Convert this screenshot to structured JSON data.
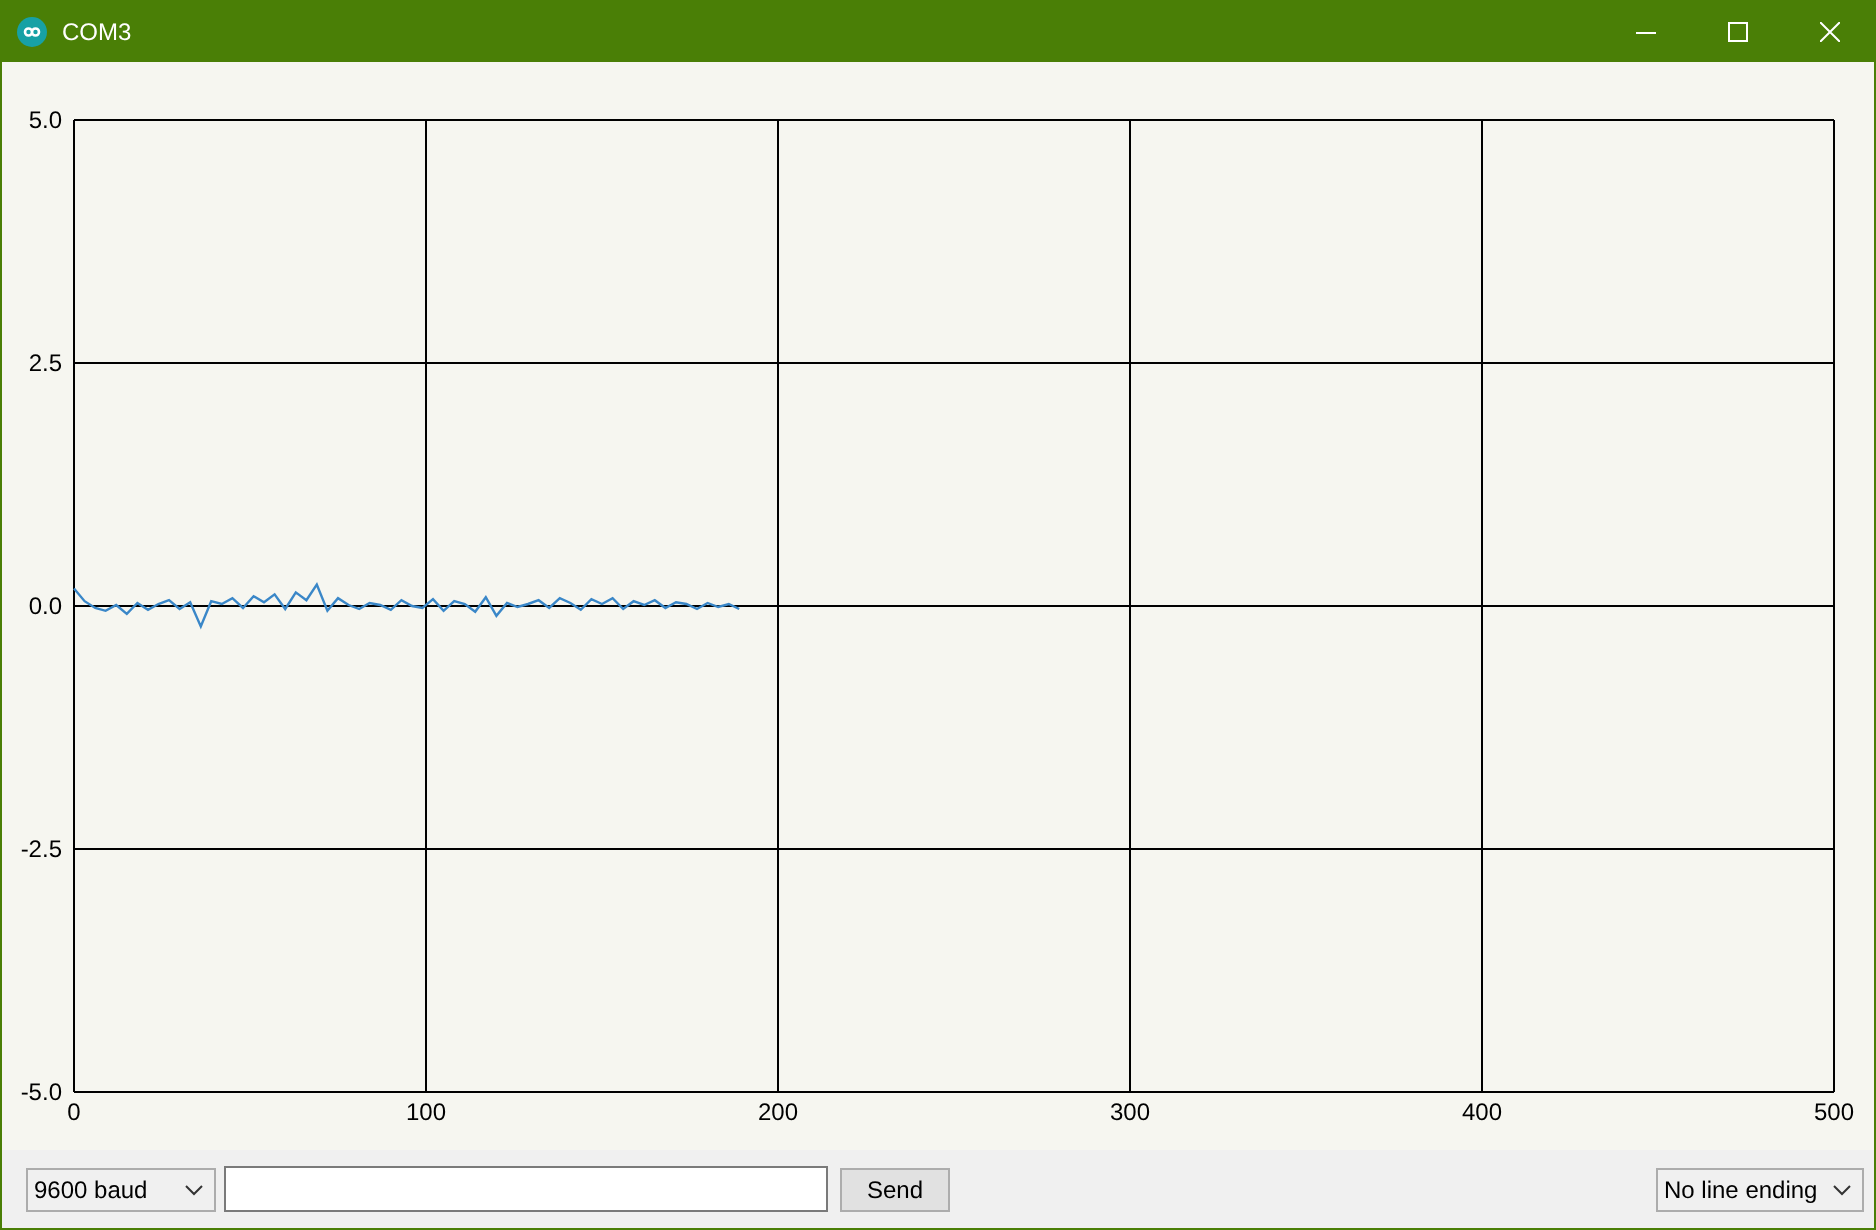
{
  "window": {
    "title": "COM3"
  },
  "plot": {
    "chart_data": {
      "type": "line",
      "grid": true,
      "xlim": [
        0,
        500
      ],
      "ylim": [
        -5,
        5
      ],
      "xticks": [
        0,
        100,
        200,
        300,
        400,
        500
      ],
      "yticks": [
        {
          "value": 5,
          "label": "5.0"
        },
        {
          "value": 2.5,
          "label": "2.5"
        },
        {
          "value": 0,
          "label": "0.0"
        },
        {
          "value": -2.5,
          "label": "-2.5"
        },
        {
          "value": -5,
          "label": "-5.0"
        }
      ],
      "x": [
        0,
        3,
        6,
        9,
        12,
        15,
        18,
        21,
        24,
        27,
        30,
        33,
        36,
        39,
        42,
        45,
        48,
        51,
        54,
        57,
        60,
        63,
        66,
        69,
        72,
        75,
        78,
        81,
        84,
        87,
        90,
        93,
        96,
        99,
        102,
        105,
        108,
        111,
        114,
        117,
        120,
        123,
        126,
        129,
        132,
        135,
        138,
        141,
        144,
        147,
        150,
        153,
        156,
        159,
        162,
        165,
        168,
        171,
        174,
        177,
        180,
        183,
        186,
        189
      ],
      "series": [
        {
          "color": "#3a87c8",
          "values": [
            0.18,
            0.05,
            -0.02,
            -0.05,
            0.01,
            -0.08,
            0.03,
            -0.04,
            0.02,
            0.06,
            -0.03,
            0.04,
            -0.21,
            0.05,
            0.02,
            0.08,
            -0.02,
            0.1,
            0.04,
            0.12,
            -0.03,
            0.14,
            0.06,
            0.22,
            -0.05,
            0.08,
            0.01,
            -0.03,
            0.03,
            0.01,
            -0.04,
            0.06,
            0.0,
            -0.02,
            0.07,
            -0.05,
            0.05,
            0.02,
            -0.06,
            0.09,
            -0.1,
            0.03,
            -0.01,
            0.02,
            0.06,
            -0.02,
            0.08,
            0.03,
            -0.04,
            0.07,
            0.02,
            0.08,
            -0.03,
            0.05,
            0.01,
            0.06,
            -0.02,
            0.04,
            0.02,
            -0.03,
            0.03,
            -0.01,
            0.02,
            -0.03
          ]
        }
      ]
    }
  },
  "bottom_bar": {
    "baud": {
      "value": "9600 baud"
    },
    "send_button": "Send",
    "line_ending": {
      "value": "No line ending"
    }
  }
}
